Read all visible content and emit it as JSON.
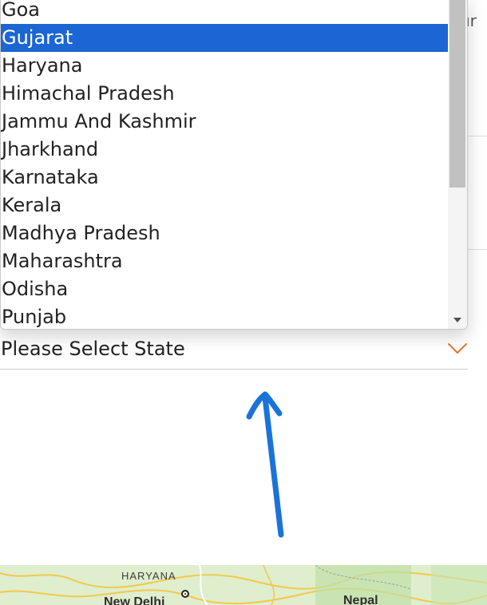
{
  "background": {
    "cut_text": "ur"
  },
  "dropdown": {
    "options": [
      "Goa",
      "Gujarat",
      "Haryana",
      "Himachal Pradesh",
      "Jammu And Kashmir",
      "Jharkhand",
      "Karnataka",
      "Kerala",
      "Madhya Pradesh",
      "Maharashtra",
      "Odisha",
      "Punjab"
    ],
    "selected_option": "Gujarat",
    "highlight_color": "#1b66d2"
  },
  "select": {
    "value": "Please Select State",
    "chevron_color": "#e07a2e"
  },
  "annotation": {
    "arrow_color": "#1a73d9",
    "icon": "hand-drawn-arrow-up-icon"
  },
  "map": {
    "labels": {
      "haryana": "HARYANA",
      "new_delhi": "New Delhi",
      "nepal": "Nepal"
    }
  }
}
